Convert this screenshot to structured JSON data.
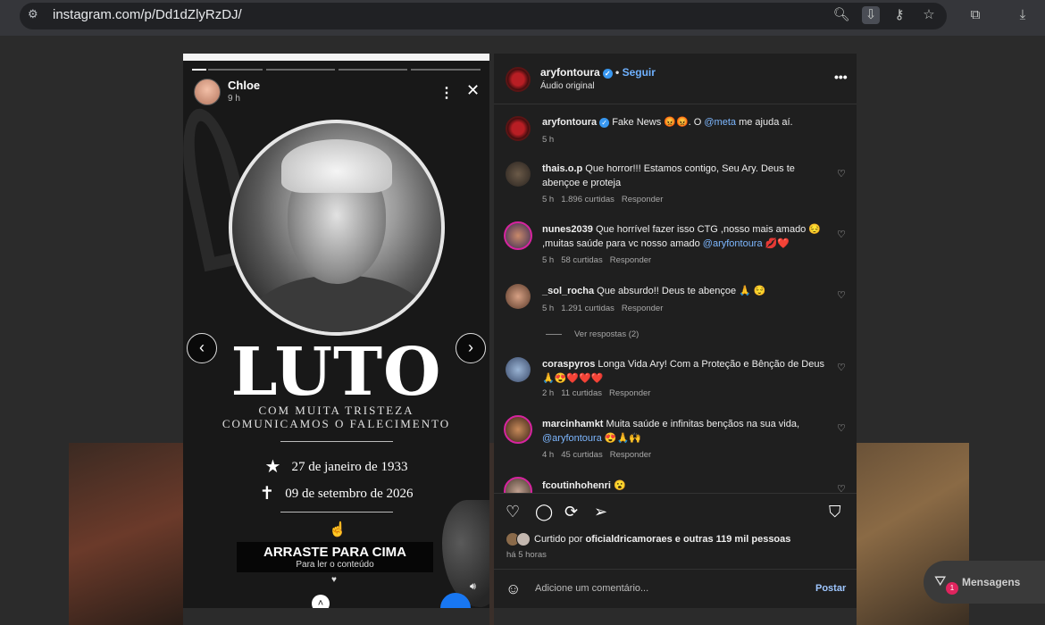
{
  "browser": {
    "url": "instagram.com/p/Dd1dZlyRzDJ/",
    "icons": [
      "site-info-icon",
      "zoom-icon",
      "install-icon",
      "password-key-icon",
      "bookmark-star-icon",
      "extensions-icon",
      "download-icon"
    ]
  },
  "story": {
    "user": "Chloe",
    "time": "9 h",
    "headline": "LUTO",
    "subtitle_line1": "COM MUITA TRISTEZA",
    "subtitle_line2": "COMUNICAMOS O FALECIMENTO",
    "birth": "27 de janeiro de 1933",
    "death": "09 de setembro de 2026",
    "cta_title": "ARRASTE PARA CIMA",
    "cta_sub": "Para ler o conteúdo"
  },
  "post": {
    "user": "aryfontoura",
    "follow": "Seguir",
    "audio": "Áudio original",
    "caption_text": "Fake News 😡😡. O",
    "caption_mention": "@meta",
    "caption_after": "me ajuda aí.",
    "caption_time": "5 h"
  },
  "comments": [
    {
      "user": "thais.o.p",
      "text": "Que horror!!! Estamos contigo, Seu Ary. Deus te abençoe e proteja",
      "time": "5 h",
      "likes": "1.896 curtidas",
      "reply": "Responder"
    },
    {
      "user": "nunes2039",
      "text": "Que horrível fazer isso CTG ,nosso mais amado 😔 ,muitas saúde para vc nosso amado",
      "mention": "@aryfontoura",
      "tail": "💋❤️",
      "time": "5 h",
      "likes": "58 curtidas",
      "reply": "Responder"
    },
    {
      "user": "_sol_rocha",
      "text": "Que absurdo!! Deus te abençoe 🙏 😌",
      "time": "5 h",
      "likes": "1.291 curtidas",
      "reply": "Responder"
    },
    {
      "user": "coraspyros",
      "text": "Longa Vida Ary! Com a Proteção e Bênção de Deus 🙏😍❤️❤️❤️",
      "time": "2 h",
      "likes": "11 curtidas",
      "reply": "Responder"
    },
    {
      "user": "marcinhamkt",
      "text": "Muita saúde e infinitas bençãos na sua vida,",
      "mention": "@aryfontoura",
      "tail": "😍🙏🙌",
      "time": "4 h",
      "likes": "45 curtidas",
      "reply": "Responder"
    },
    {
      "user": "fcoutinhohenri",
      "text": "😮",
      "time": "",
      "likes": "",
      "reply": ""
    }
  ],
  "view_replies": "Ver respostas (2)",
  "liked_by_prefix": "Curtido por",
  "liked_by_user": "oficialdricamoraes",
  "liked_by_suffix": "e outras 119 mil pessoas",
  "post_age": "há 5 horas",
  "comment_placeholder": "Adicione um comentário...",
  "post_label": "Postar",
  "messages": {
    "label": "Mensagens",
    "badge": "1"
  }
}
